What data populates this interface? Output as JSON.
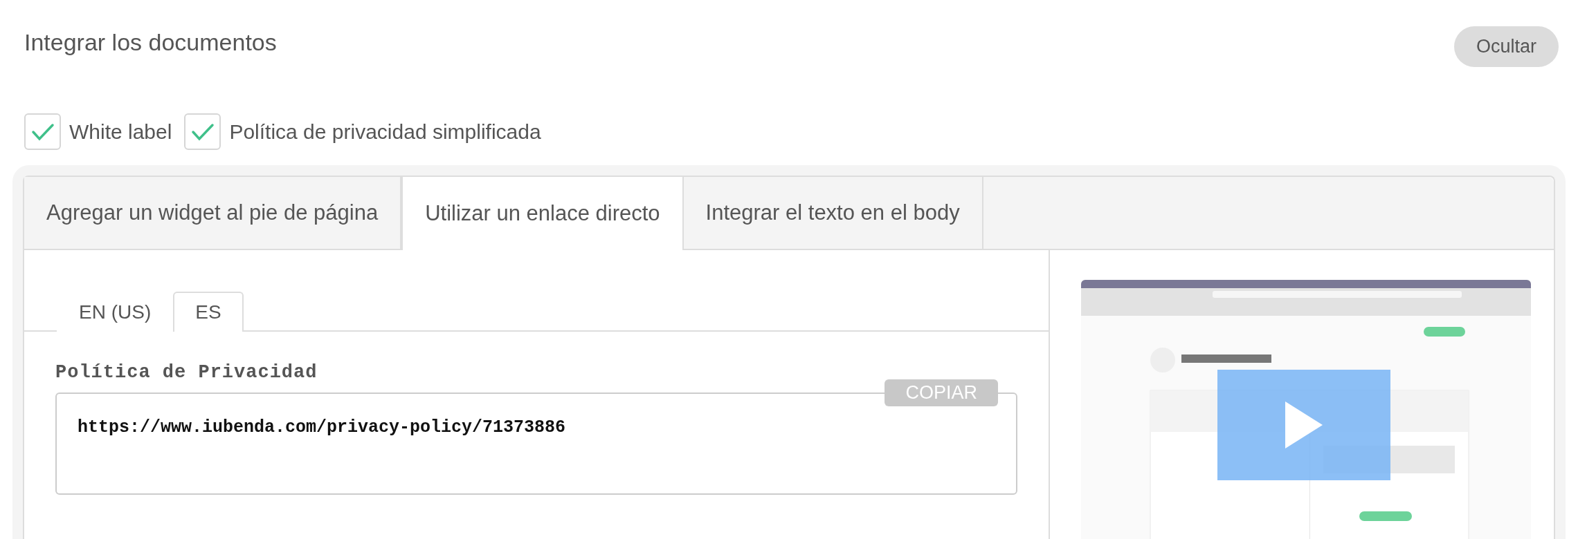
{
  "header": {
    "title": "Integrar los documentos",
    "hide_button": "Ocultar"
  },
  "options": [
    {
      "label": "White label",
      "checked": true
    },
    {
      "label": "Política de privacidad simplificada",
      "checked": true
    }
  ],
  "tabs": [
    {
      "label": "Agregar un widget al pie de página",
      "selected": false
    },
    {
      "label": "Utilizar un enlace directo",
      "selected": true
    },
    {
      "label": "Integrar el texto en el body",
      "selected": false
    }
  ],
  "languages": [
    {
      "label": "EN (US)",
      "selected": false
    },
    {
      "label": "ES",
      "selected": true
    }
  ],
  "link": {
    "label": "Política de Privacidad",
    "copy_button": "COPIAR",
    "value": "https://www.iubenda.com/privacy-policy/71373886"
  }
}
